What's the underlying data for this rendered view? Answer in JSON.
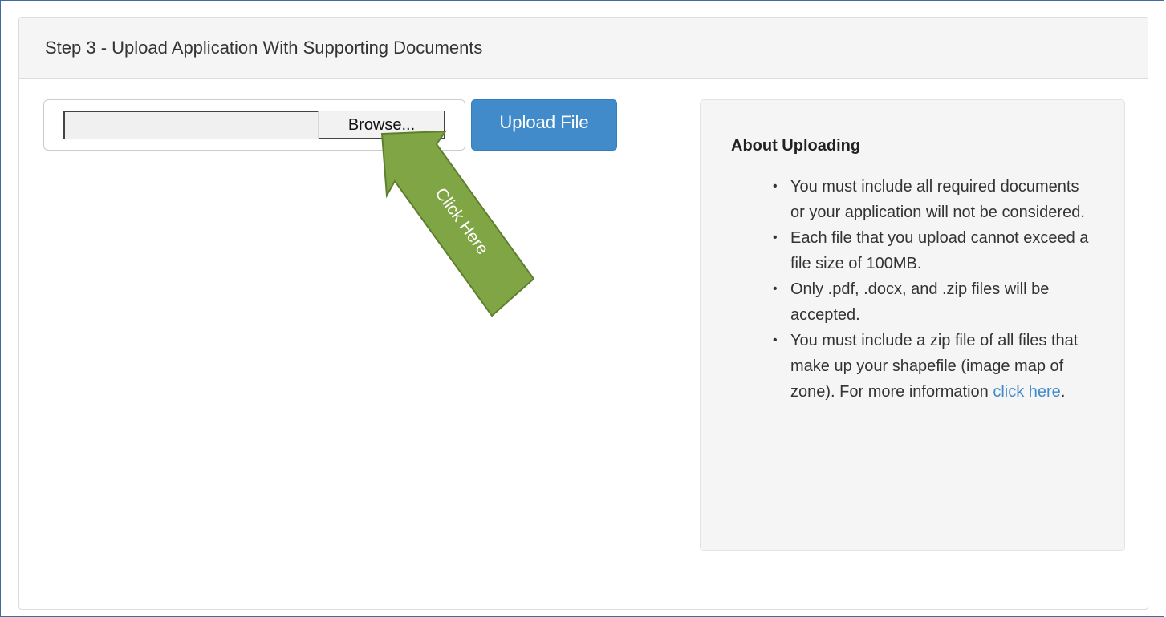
{
  "panel": {
    "title": "Step 3 - Upload Application With Supporting Documents"
  },
  "upload": {
    "browse_label": "Browse...",
    "upload_label": "Upload File",
    "file_value": ""
  },
  "annotation": {
    "arrow_label": "Click Here",
    "arrow_color": "#7fa545"
  },
  "about": {
    "title": "About Uploading",
    "items": [
      "You must include all required documents or your application will not be considered.",
      "Each file that you upload cannot exceed a file size of 100MB.",
      "Only .pdf, .docx, and .zip files will be accepted.",
      "You must include a zip file of all files that make up your shapefile (image map of zone). For more information "
    ],
    "link_text": "click here",
    "link_suffix": "."
  },
  "colors": {
    "primary_button": "#428bca",
    "header_bg": "#f5f5f5",
    "well_bg": "#f5f5f5",
    "link": "#428bca"
  }
}
